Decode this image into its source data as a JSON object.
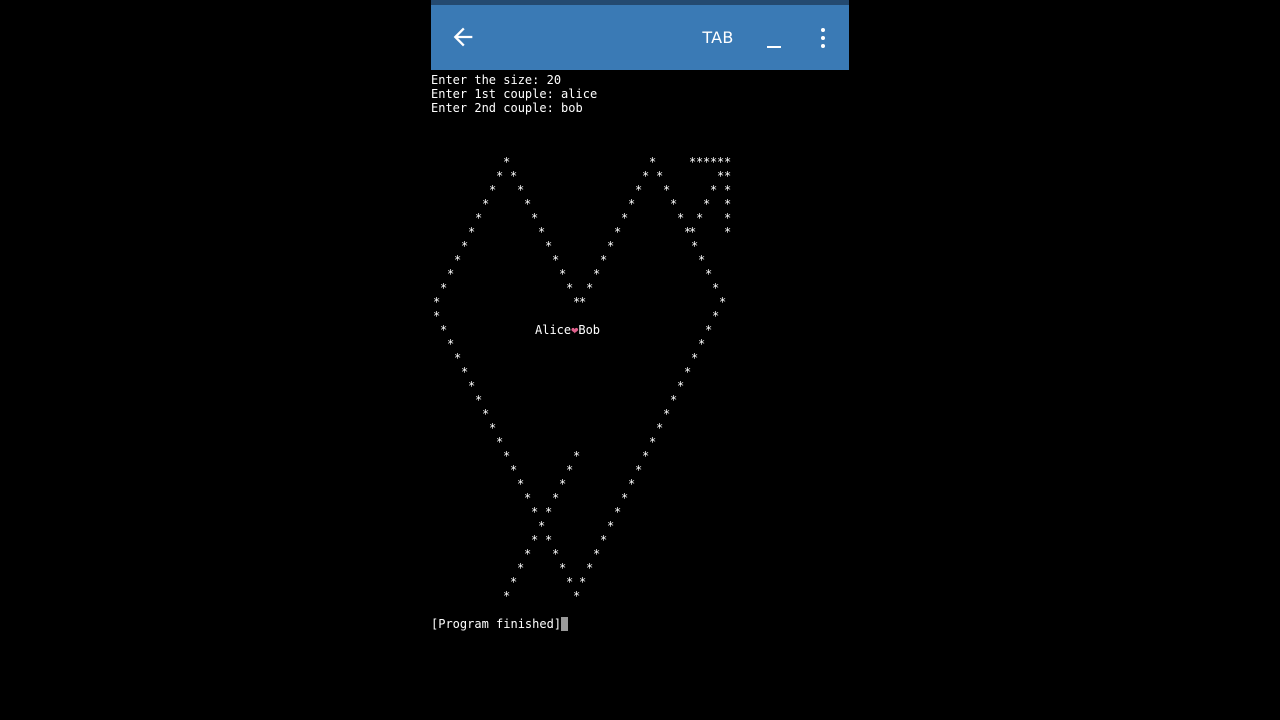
{
  "toolbar": {
    "back_icon": "arrow-left-icon",
    "tab_label": "TAB",
    "underscore_icon": "underscore-key-icon",
    "menu_icon": "more-vert-icon",
    "background_color": "#3a7ab5"
  },
  "terminal": {
    "prompt_lines": [
      "Enter the size: 20",
      "Enter 1st couple: alice",
      "Enter 2nd couple: bob"
    ],
    "label_left": "Alice",
    "label_heart": "❤",
    "label_right": "Bob",
    "finished": "[Program finished]",
    "art_glyph": "*",
    "heart_color": "#e0608c"
  }
}
